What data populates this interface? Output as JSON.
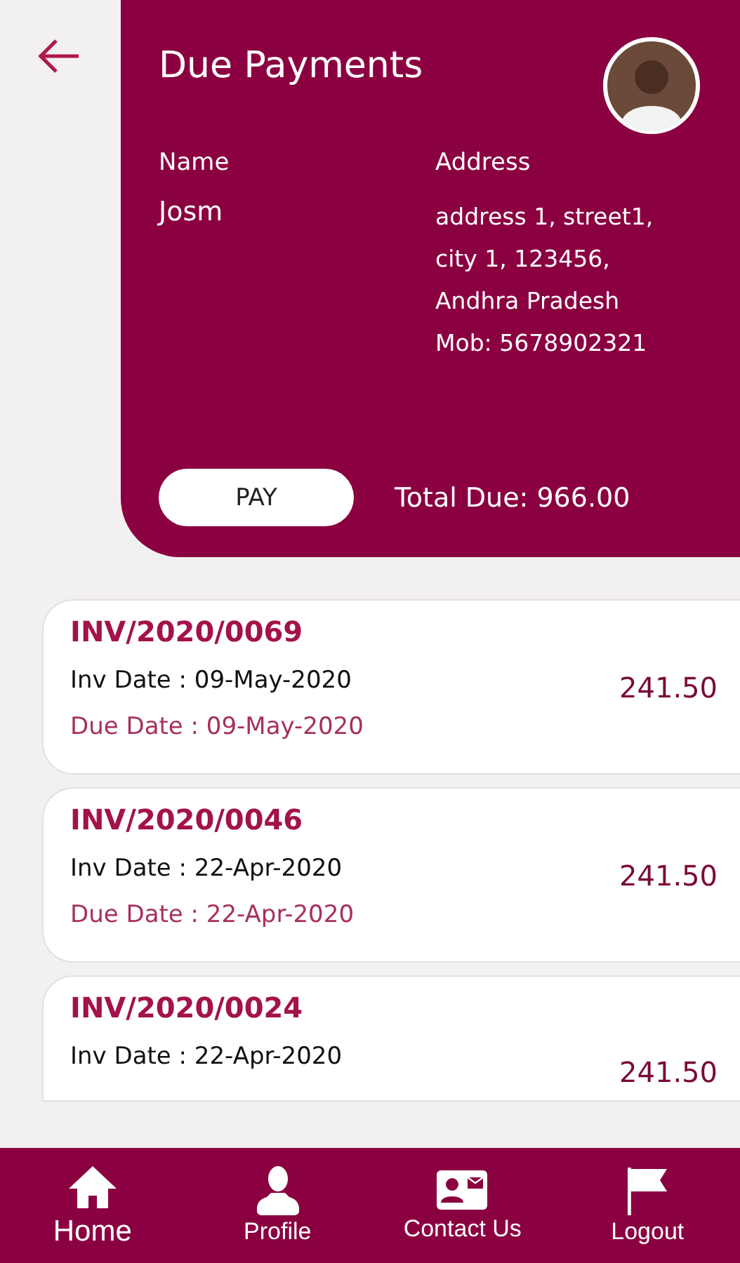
{
  "header": {
    "title": "Due Payments",
    "name_label": "Name",
    "name": "Josm",
    "address_label": "Address",
    "address_lines": [
      "address 1, street1,",
      "city 1, 123456,",
      "Andhra Pradesh",
      "Mob: 5678902321"
    ],
    "pay_button": "PAY",
    "total_due": "Total Due: 966.00"
  },
  "invoices": [
    {
      "number": "INV/2020/0069",
      "inv_date": "Inv Date : 09-May-2020",
      "due_date": "Due Date : 09-May-2020",
      "amount": "241.50"
    },
    {
      "number": "INV/2020/0046",
      "inv_date": "Inv Date : 22-Apr-2020",
      "due_date": "Due Date : 22-Apr-2020",
      "amount": "241.50"
    },
    {
      "number": "INV/2020/0024",
      "inv_date": "Inv Date : 22-Apr-2020",
      "amount": "241.50"
    }
  ],
  "nav": [
    {
      "kind": "home",
      "label": "Home",
      "selected": true
    },
    {
      "kind": "profile",
      "label": "Profile",
      "selected": false
    },
    {
      "kind": "contact",
      "label": "Contact Us",
      "selected": false
    },
    {
      "kind": "logout",
      "label": "Logout",
      "selected": false
    }
  ]
}
